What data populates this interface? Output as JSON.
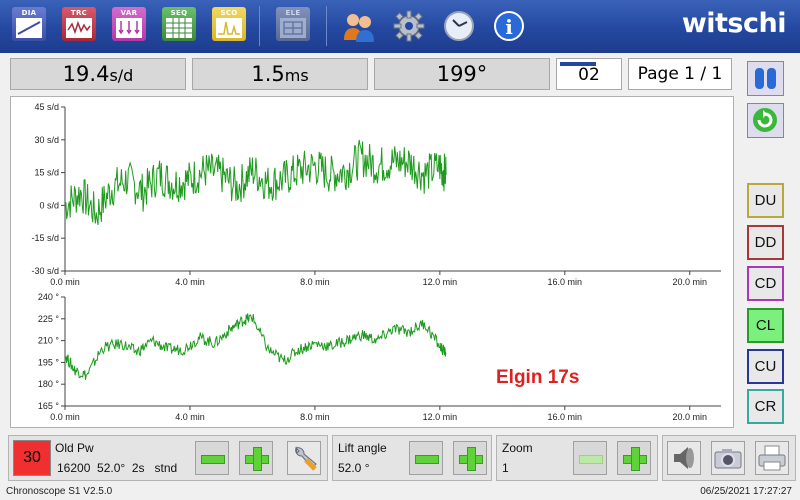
{
  "toolbar": {
    "buttons": [
      {
        "label": "DIA",
        "color": "#3b4ea8"
      },
      {
        "label": "TRC",
        "color": "#a8283a"
      },
      {
        "label": "VAR",
        "color": "#b03aa8"
      },
      {
        "label": "SEQ",
        "color": "#3a8a3a"
      },
      {
        "label": "SCO",
        "color": "#d8b82a"
      },
      {
        "label": "ELE",
        "color": "#7a86a8"
      }
    ],
    "brand": "witschi"
  },
  "readouts": {
    "rate_value": "19.4",
    "rate_unit": "s/d",
    "amplitude_value": "1.5",
    "amplitude_unit": "ms",
    "beat_angle_value": "199°",
    "counter": "02",
    "page": "Page 1 / 1"
  },
  "side_buttons": [
    {
      "label": "DU",
      "color": "#b8a840",
      "bg": "#e8e8e8"
    },
    {
      "label": "DD",
      "color": "#a83838",
      "bg": "#e8e8e8"
    },
    {
      "label": "CD",
      "color": "#a838b8",
      "bg": "#e8e8e8"
    },
    {
      "label": "CL",
      "color": "#2a9a2a",
      "bg": "#7cf07c"
    },
    {
      "label": "CU",
      "color": "#283898",
      "bg": "#e8e8e8"
    },
    {
      "label": "CR",
      "color": "#38a8a0",
      "bg": "#e8e8e8"
    }
  ],
  "annotation": "Elgin 17s",
  "chart_data": [
    {
      "type": "line",
      "x_unit": "min",
      "x_ticks": [
        "0.0 min",
        "4.0 min",
        "8.0 min",
        "12.0 min",
        "16.0 min",
        "20.0 min"
      ],
      "xlim": [
        0,
        21
      ],
      "y_ticks": [
        "45 s/d",
        "30 s/d",
        "15 s/d",
        "0 s/d",
        "-15 s/d",
        "-30 s/d"
      ],
      "ylim": [
        -30,
        45
      ],
      "color": "#1e9a1e",
      "x": [
        0,
        0.5,
        1,
        1.5,
        2,
        2.5,
        3,
        3.5,
        4,
        4.5,
        5,
        5.5,
        6,
        6.5,
        7,
        7.5,
        8,
        8.5,
        9,
        9.5,
        10,
        10.5,
        11,
        11.5,
        12,
        12.2
      ],
      "values": [
        0,
        6,
        -4,
        8,
        12,
        6,
        14,
        10,
        12,
        16,
        14,
        8,
        16,
        10,
        12,
        16,
        18,
        14,
        16,
        22,
        18,
        20,
        20,
        14,
        18,
        14
      ]
    },
    {
      "type": "line",
      "x_unit": "min",
      "x_ticks": [
        "0.0 min",
        "4.0 min",
        "8.0 min",
        "12.0 min",
        "16.0 min",
        "20.0 min"
      ],
      "xlim": [
        0,
        21
      ],
      "y_ticks": [
        "240 °",
        "225 °",
        "210 °",
        "195 °",
        "180 °",
        "165 °"
      ],
      "ylim": [
        165,
        240
      ],
      "color": "#1e9a1e",
      "x": [
        0,
        0.3,
        0.7,
        1.2,
        1.8,
        2.3,
        2.8,
        3.3,
        3.8,
        4.3,
        4.8,
        5.3,
        5.7,
        6,
        6.5,
        7,
        7.5,
        8,
        8.5,
        9,
        9.5,
        10,
        10.5,
        11,
        11.5,
        12,
        12.2
      ],
      "values": [
        200,
        190,
        186,
        205,
        208,
        202,
        210,
        204,
        204,
        212,
        208,
        218,
        224,
        226,
        204,
        196,
        204,
        208,
        206,
        210,
        214,
        210,
        218,
        216,
        222,
        206,
        201
      ]
    }
  ],
  "bottom": {
    "old_pw_count": "30",
    "old_pw_label": "Old Pw",
    "old_pw_detail": "16200  52.0°  2s   stnd",
    "lift_angle_label": "Lift angle",
    "lift_angle_value": "52.0 °",
    "zoom_label": "Zoom",
    "zoom_value": "1"
  },
  "footer": {
    "version": "Chronoscope S1 V2.5.0",
    "datetime": "06/25/2021 17:27:27"
  }
}
